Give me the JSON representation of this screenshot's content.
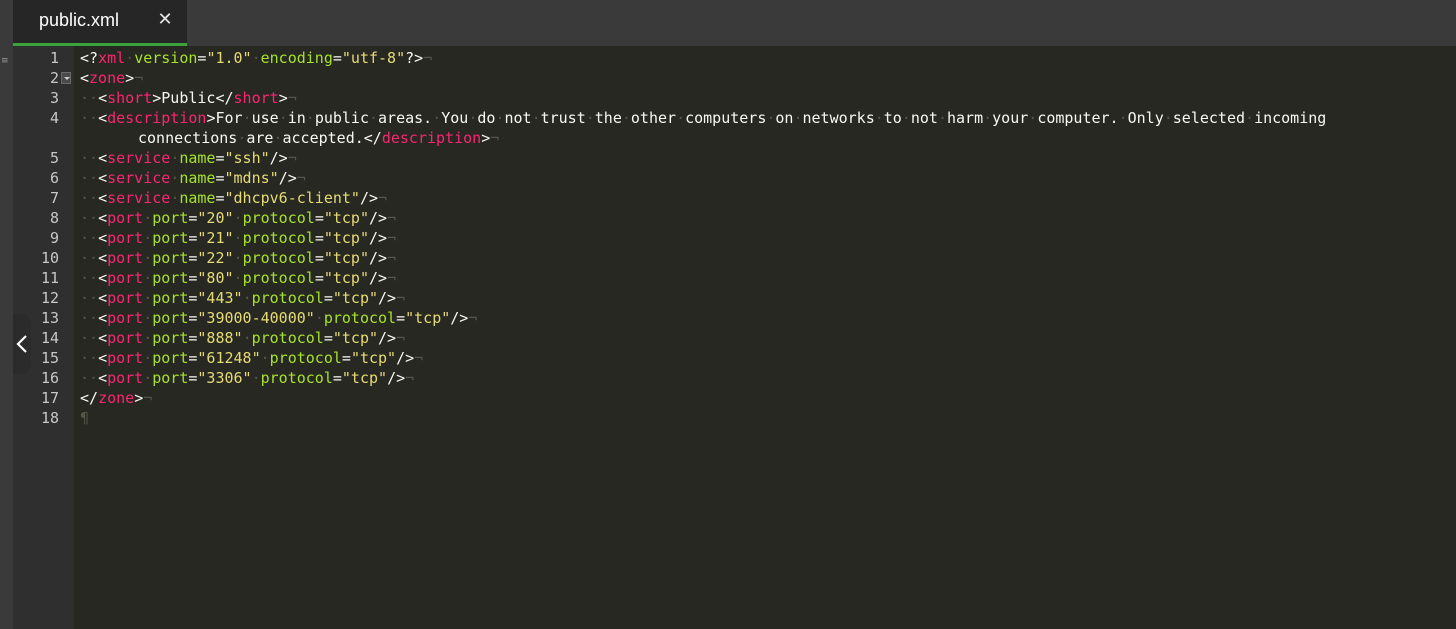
{
  "tab": {
    "title": "public.xml",
    "close_glyph": "✕"
  },
  "left_strip": {
    "mark": "≡"
  },
  "icons": {
    "close": "close-icon",
    "fold": "fold-triangle-icon",
    "collapse": "chevron-left-icon"
  },
  "colors": {
    "tag": "#f92672",
    "attribute": "#a6e22e",
    "string": "#e6db74",
    "text": "#f8f8f2",
    "whitespace_marker": "#555549",
    "active_tab_underline": "#3ca33c"
  },
  "editor": {
    "lines": [
      {
        "number": "1",
        "text": "<?xml·version=\"1.0\"·encoding=\"utf-8\"?>¬"
      },
      {
        "number": "2",
        "text": "<zone>¬"
      },
      {
        "number": "3",
        "text": "··<short>Public</short>¬"
      },
      {
        "number": "4",
        "text": "··<description>For·use·in·public·areas.·You·do·not·trust·the·other·computers·on·networks·to·not·harm·your·computer.·Only·selected·incoming",
        "continuation": "connections·are·accepted.</description>¬"
      },
      {
        "number": "5",
        "text": "··<service·name=\"ssh\"/>¬"
      },
      {
        "number": "6",
        "text": "··<service·name=\"mdns\"/>¬"
      },
      {
        "number": "7",
        "text": "··<service·name=\"dhcpv6-client\"/>¬"
      },
      {
        "number": "8",
        "text": "··<port·port=\"20\"·protocol=\"tcp\"/>¬"
      },
      {
        "number": "9",
        "text": "··<port·port=\"21\"·protocol=\"tcp\"/>¬"
      },
      {
        "number": "10",
        "text": "··<port·port=\"22\"·protocol=\"tcp\"/>¬"
      },
      {
        "number": "11",
        "text": "··<port·port=\"80\"·protocol=\"tcp\"/>¬"
      },
      {
        "number": "12",
        "text": "··<port·port=\"443\"·protocol=\"tcp\"/>¬"
      },
      {
        "number": "13",
        "text": "··<port·port=\"39000-40000\"·protocol=\"tcp\"/>¬"
      },
      {
        "number": "14",
        "text": "··<port·port=\"888\"·protocol=\"tcp\"/>¬"
      },
      {
        "number": "15",
        "text": "··<port·port=\"61248\"·protocol=\"tcp\"/>¬"
      },
      {
        "number": "16",
        "text": "··<port·port=\"3306\"·protocol=\"tcp\"/>¬"
      },
      {
        "number": "17",
        "text": "</zone>¬"
      },
      {
        "number": "18",
        "text": "¶"
      }
    ]
  }
}
